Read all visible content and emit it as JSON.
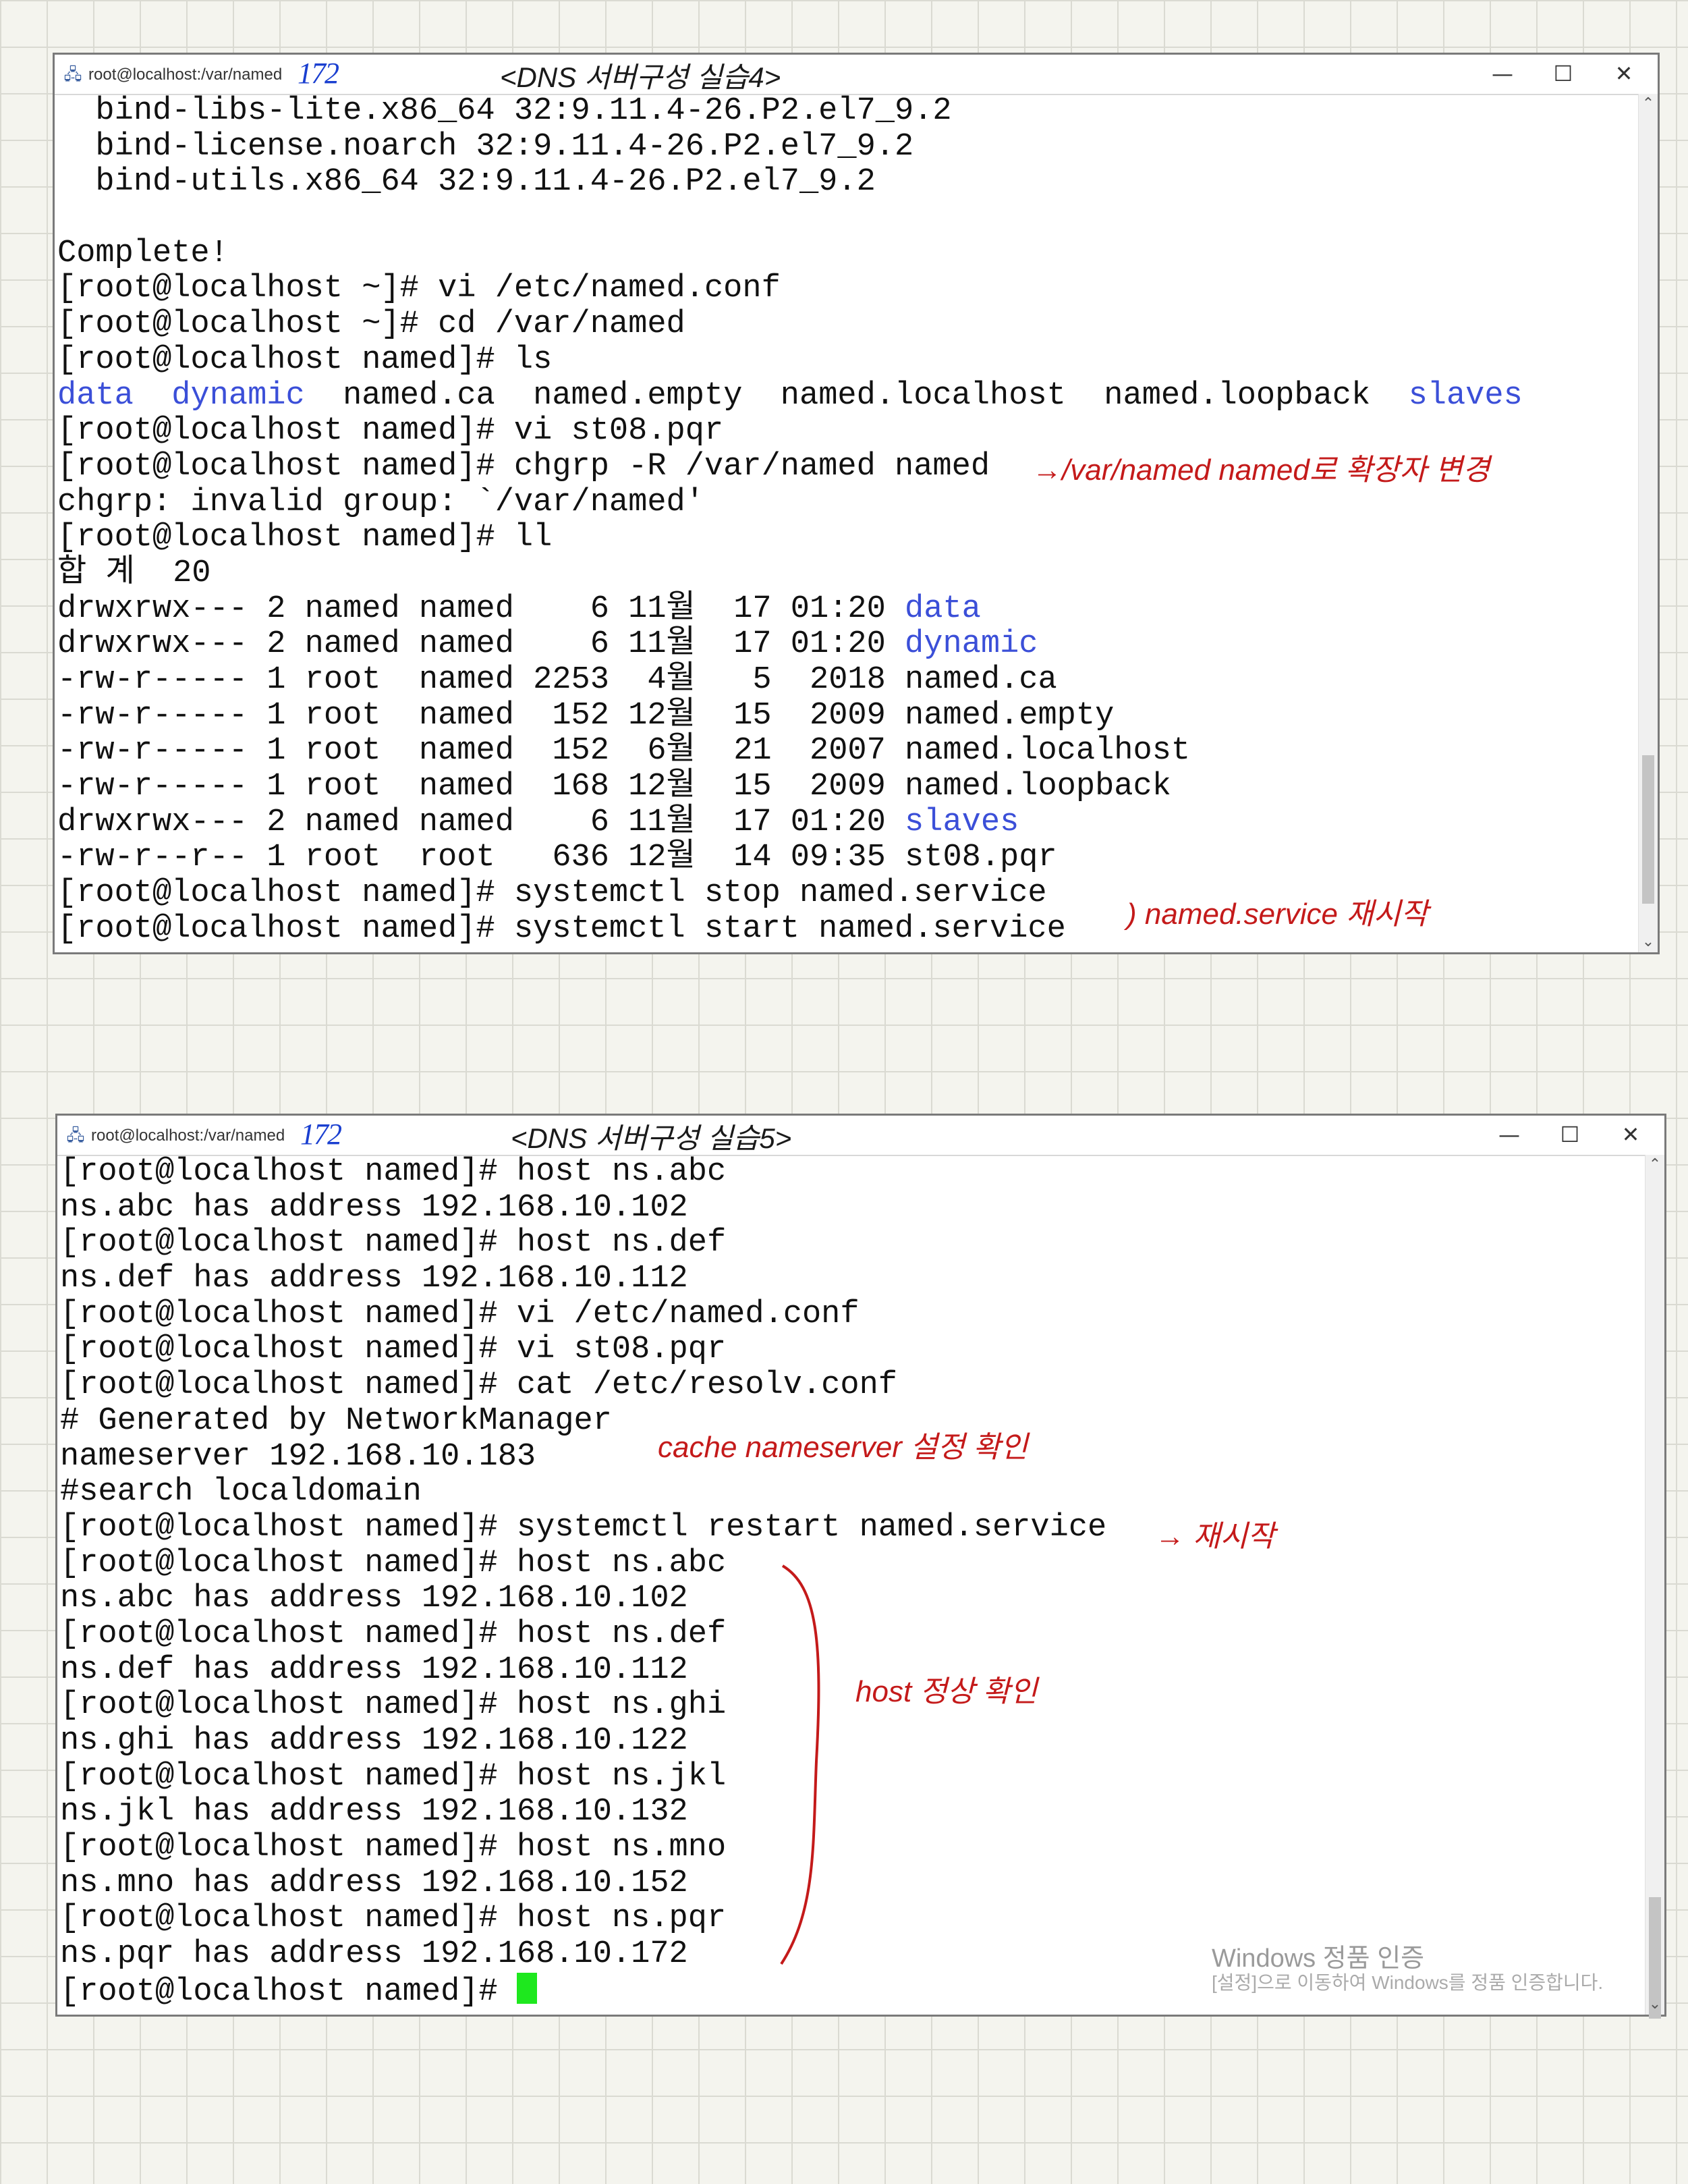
{
  "window1": {
    "title": "root@localhost:/var/named",
    "ink_number": "172",
    "ink_title": "<DNS 서버구성 실습4>",
    "controls": {
      "minimize": "—",
      "maximize": "☐",
      "close": "✕"
    },
    "lines": [
      [
        {
          "t": "  bind-libs-lite.x86_64 32:9.11.4-26.P2.el7_9.2"
        }
      ],
      [
        {
          "t": "  bind-license.noarch 32:9.11.4-26.P2.el7_9.2"
        }
      ],
      [
        {
          "t": "  bind-utils.x86_64 32:9.11.4-26.P2.el7_9.2"
        }
      ],
      [
        {
          "t": ""
        }
      ],
      [
        {
          "t": "Complete!"
        }
      ],
      [
        {
          "t": "[root@localhost ~]# vi /etc/named.conf"
        }
      ],
      [
        {
          "t": "[root@localhost ~]# cd /var/named"
        }
      ],
      [
        {
          "t": "[root@localhost named]# ls"
        }
      ],
      [
        {
          "t": "data",
          "c": "dir"
        },
        {
          "t": "  "
        },
        {
          "t": "dynamic",
          "c": "dir"
        },
        {
          "t": "  named.ca  named.empty  named.localhost  named.loopback  "
        },
        {
          "t": "slaves",
          "c": "dir"
        }
      ],
      [
        {
          "t": "[root@localhost named]# vi st08.pqr"
        }
      ],
      [
        {
          "t": "[root@localhost named]# chgrp -R /var/named named"
        }
      ],
      [
        {
          "t": "chgrp: invalid group: `/var/named'"
        }
      ],
      [
        {
          "t": "[root@localhost named]# ll"
        }
      ],
      [
        {
          "t": "합 계  20"
        }
      ],
      [
        {
          "t": "drwxrwx--- 2 named named    6 11월  17 01:20 "
        },
        {
          "t": "data",
          "c": "dir"
        }
      ],
      [
        {
          "t": "drwxrwx--- 2 named named    6 11월  17 01:20 "
        },
        {
          "t": "dynamic",
          "c": "dir"
        }
      ],
      [
        {
          "t": "-rw-r----- 1 root  named 2253  4월   5  2018 named.ca"
        }
      ],
      [
        {
          "t": "-rw-r----- 1 root  named  152 12월  15  2009 named.empty"
        }
      ],
      [
        {
          "t": "-rw-r----- 1 root  named  152  6월  21  2007 named.localhost"
        }
      ],
      [
        {
          "t": "-rw-r----- 1 root  named  168 12월  15  2009 named.loopback"
        }
      ],
      [
        {
          "t": "drwxrwx--- 2 named named    6 11월  17 01:20 "
        },
        {
          "t": "slaves",
          "c": "dir"
        }
      ],
      [
        {
          "t": "-rw-r--r-- 1 root  root   636 12월  14 09:35 st08.pqr"
        }
      ],
      [
        {
          "t": "[root@localhost named]# systemctl stop named.service"
        }
      ],
      [
        {
          "t": "[root@localhost named]# systemctl start named.service"
        }
      ]
    ],
    "annotations": {
      "chgrp_note": "→/var/named named로 확장자 변경",
      "restart_note": ") named.service 재시작"
    }
  },
  "window2": {
    "title": "root@localhost:/var/named",
    "ink_number": "172",
    "ink_title": "<DNS 서버구성 실습5>",
    "controls": {
      "minimize": "—",
      "maximize": "☐",
      "close": "✕"
    },
    "lines": [
      [
        {
          "t": "[root@localhost named]# host ns.abc"
        }
      ],
      [
        {
          "t": "ns.abc has address 192.168.10.102"
        }
      ],
      [
        {
          "t": "[root@localhost named]# host ns.def"
        }
      ],
      [
        {
          "t": "ns.def has address 192.168.10.112"
        }
      ],
      [
        {
          "t": "[root@localhost named]# vi /etc/named.conf"
        }
      ],
      [
        {
          "t": "[root@localhost named]# vi st08.pqr"
        }
      ],
      [
        {
          "t": "[root@localhost named]# cat /etc/resolv.conf"
        }
      ],
      [
        {
          "t": "# Generated by NetworkManager"
        }
      ],
      [
        {
          "t": "nameserver 192.168.10.183"
        }
      ],
      [
        {
          "t": "#search localdomain"
        }
      ],
      [
        {
          "t": "[root@localhost named]# systemctl restart named.service"
        }
      ],
      [
        {
          "t": "[root@localhost named]# host ns.abc"
        }
      ],
      [
        {
          "t": "ns.abc has address 192.168.10.102"
        }
      ],
      [
        {
          "t": "[root@localhost named]# host ns.def"
        }
      ],
      [
        {
          "t": "ns.def has address 192.168.10.112"
        }
      ],
      [
        {
          "t": "[root@localhost named]# host ns.ghi"
        }
      ],
      [
        {
          "t": "ns.ghi has address 192.168.10.122"
        }
      ],
      [
        {
          "t": "[root@localhost named]# host ns.jkl"
        }
      ],
      [
        {
          "t": "ns.jkl has address 192.168.10.132"
        }
      ],
      [
        {
          "t": "[root@localhost named]# host ns.mno"
        }
      ],
      [
        {
          "t": "ns.mno has address 192.168.10.152"
        }
      ],
      [
        {
          "t": "[root@localhost named]# host ns.pqr"
        }
      ],
      [
        {
          "t": "ns.pqr has address 192.168.10.172"
        }
      ],
      [
        {
          "t": "[root@localhost named]# "
        },
        {
          "cursor": true
        }
      ]
    ],
    "annotations": {
      "cache_note": "cache nameserver 설정 확인",
      "restart_note": "→ 재시작",
      "host_note": "host 정상 확인"
    }
  },
  "watermark": {
    "line1": "Windows 정품 인증",
    "line2": "[설정]으로 이동하여 Windows를 정품 인증합니다."
  },
  "colors": {
    "directory_blue": "#3b4fd8",
    "annotation_red": "#c41a1a",
    "ink_blue": "#1a3fd0",
    "cursor_green": "#1ee81e"
  }
}
